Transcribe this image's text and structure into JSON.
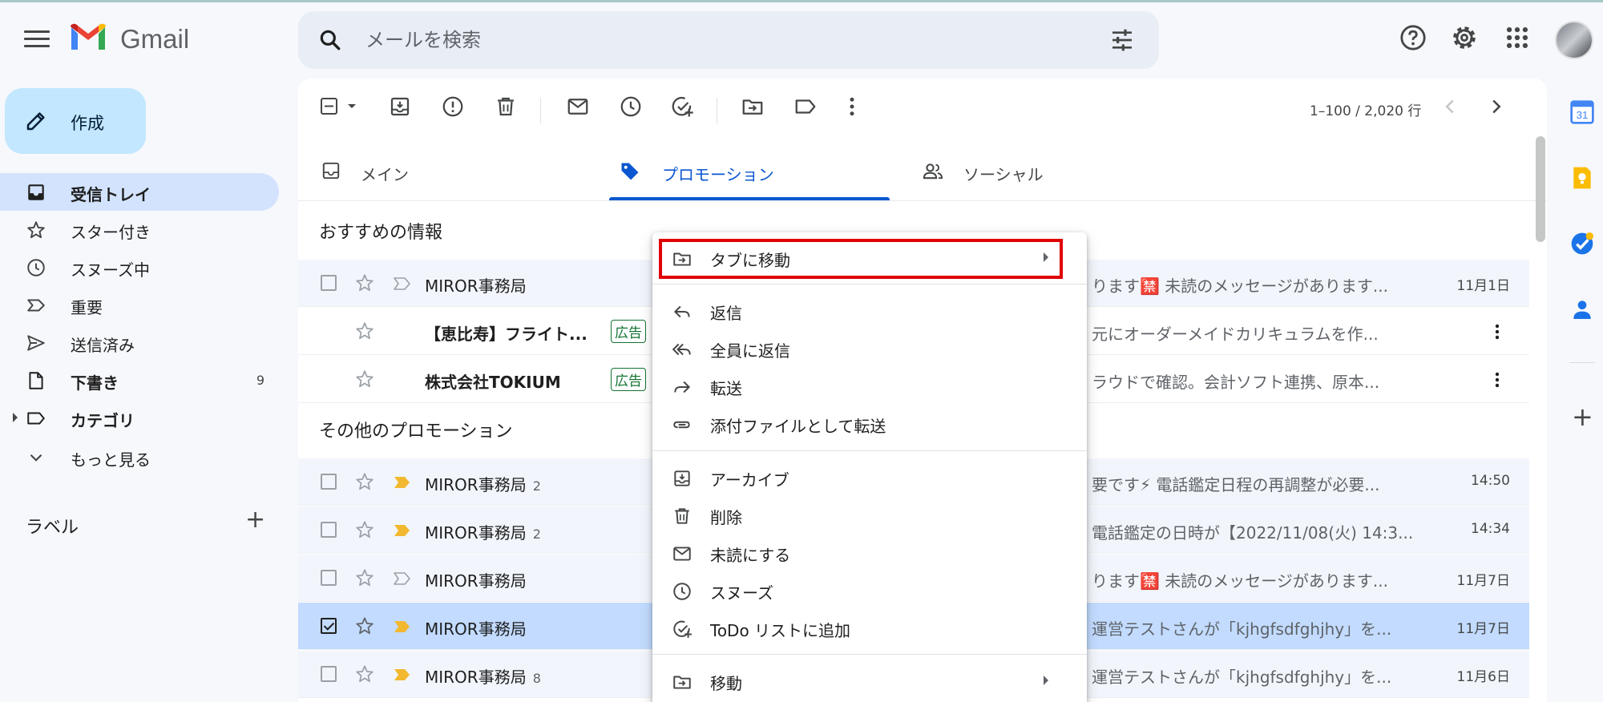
{
  "app": {
    "name": "Gmail",
    "search_placeholder": "メールを検索",
    "brand_colors": {
      "red": "#ea4335",
      "blue": "#4285f4",
      "green": "#34a853",
      "yellow": "#fbbc04"
    }
  },
  "sidebar": {
    "compose_label": "作成",
    "items": [
      {
        "label": "受信トレイ",
        "icon": "inbox-icon",
        "active": true,
        "count": ""
      },
      {
        "label": "スター付き",
        "icon": "star-icon",
        "count": ""
      },
      {
        "label": "スヌーズ中",
        "icon": "clock-icon",
        "count": ""
      },
      {
        "label": "重要",
        "icon": "important-icon",
        "count": ""
      },
      {
        "label": "送信済み",
        "icon": "send-icon",
        "count": ""
      },
      {
        "label": "下書き",
        "icon": "draft-icon",
        "count": "9"
      },
      {
        "label": "カテゴリ",
        "icon": "label-icon",
        "count": ""
      },
      {
        "label": "もっと見る",
        "icon": "chevron-down-icon",
        "count": ""
      }
    ],
    "labels_header": "ラベル",
    "labels_add": "+"
  },
  "toolbar": {
    "pager": "1–100 / 2,020 行"
  },
  "tabs": [
    {
      "label": "メイン",
      "icon": "inbox-icon",
      "active": false
    },
    {
      "label": "プロモーション",
      "icon": "tag-icon",
      "active": true
    },
    {
      "label": "ソーシャル",
      "icon": "people-icon",
      "active": false
    }
  ],
  "sections": {
    "recommended": "おすすめの情報",
    "other": "その他のプロモーション"
  },
  "emails": [
    {
      "sender": "MIROR事務局",
      "count": "",
      "snippet": "ります🈲 未読のメッセージがあります...",
      "date": "11月1日",
      "important": false,
      "ad": false,
      "state": "read"
    },
    {
      "sender": "【恵比寿】フライト...",
      "count": "",
      "snippet": "元にオーダーメイドカリキュラムを作...",
      "date": "",
      "important": false,
      "ad": true,
      "state": "unread"
    },
    {
      "sender": "株式会社TOKIUM",
      "count": "",
      "snippet": "ラウドで確認。会計ソフト連携、原本...",
      "date": "",
      "important": false,
      "ad": true,
      "state": "unread"
    },
    {
      "sender": "MIROR事務局",
      "count": "2",
      "snippet": "要です⚡ 電話鑑定日程の再調整が必要...",
      "date": "14:50",
      "important": true,
      "ad": false,
      "state": "read"
    },
    {
      "sender": "MIROR事務局",
      "count": "2",
      "snippet": "電話鑑定の日時が【2022/11/08(火) 14:3...",
      "date": "14:34",
      "important": true,
      "ad": false,
      "state": "read"
    },
    {
      "sender": "MIROR事務局",
      "count": "",
      "snippet": "ります🈲 未読のメッセージがあります...",
      "date": "11月7日",
      "important": false,
      "ad": false,
      "state": "read"
    },
    {
      "sender": "MIROR事務局",
      "count": "",
      "snippet": "運営テストさんが「kjhgfsdfghjhy」を...",
      "date": "11月7日",
      "important": true,
      "ad": false,
      "state": "selected"
    },
    {
      "sender": "MIROR事務局",
      "count": "8",
      "snippet": "運営テストさんが「kjhgfsdfghjhy」を...",
      "date": "11月6日",
      "important": true,
      "ad": false,
      "state": "read"
    }
  ],
  "ad_badge": "広告",
  "context_menu": {
    "items": [
      {
        "label": "タブに移動",
        "icon": "move-to-tab-icon",
        "submenu": true,
        "highlighted": true
      },
      {
        "label": "返信",
        "icon": "reply-icon"
      },
      {
        "label": "全員に返信",
        "icon": "reply-all-icon"
      },
      {
        "label": "転送",
        "icon": "forward-icon"
      },
      {
        "label": "添付ファイルとして転送",
        "icon": "attachment-icon"
      },
      {
        "label": "アーカイブ",
        "icon": "archive-icon"
      },
      {
        "label": "削除",
        "icon": "trash-icon"
      },
      {
        "label": "未読にする",
        "icon": "mail-icon"
      },
      {
        "label": "スヌーズ",
        "icon": "clock-icon"
      },
      {
        "label": "ToDo リストに追加",
        "icon": "add-task-icon"
      },
      {
        "label": "移動",
        "icon": "move-icon",
        "submenu": true
      }
    ]
  },
  "rail": {
    "calendar_day": "31"
  }
}
